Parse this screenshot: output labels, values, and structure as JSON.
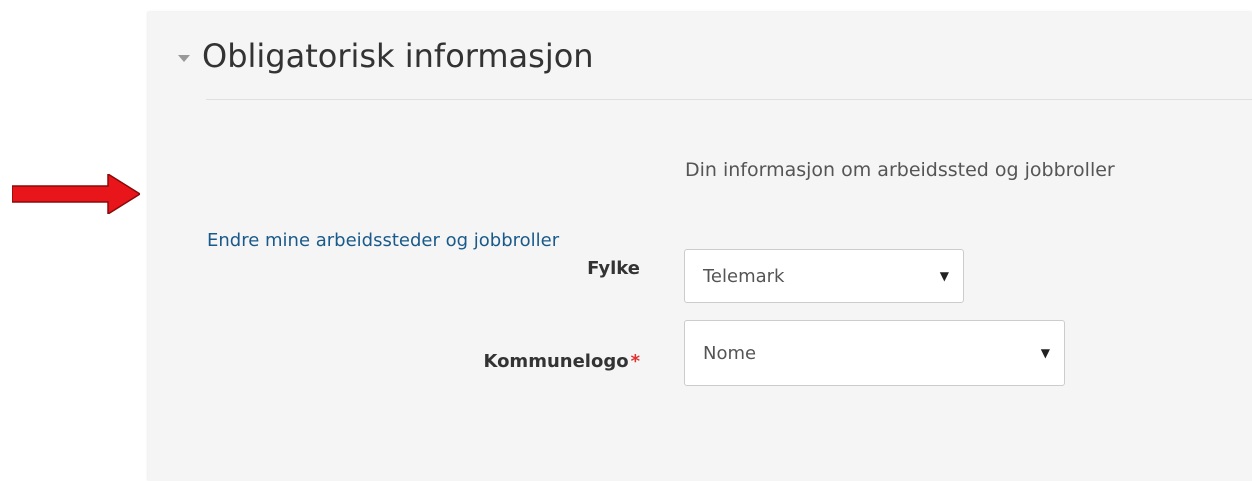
{
  "section": {
    "title": "Obligatorisk informasjon",
    "toggle_icon": "chevron-down-icon"
  },
  "form": {
    "intro_text": "Din informasjon om arbeidssted og jobbroller",
    "edit_link": "Endre mine arbeidssteder og jobbroller",
    "fields": {
      "fylke": {
        "label": "Fylke",
        "value": "Telemark"
      },
      "kommunelogo": {
        "label": "Kommunelogo",
        "required_marker": "*",
        "value": "Nome"
      }
    },
    "caret_glyph": "▼"
  },
  "annotation": {
    "icon": "red-arrow-icon",
    "color": "#e8151b"
  }
}
